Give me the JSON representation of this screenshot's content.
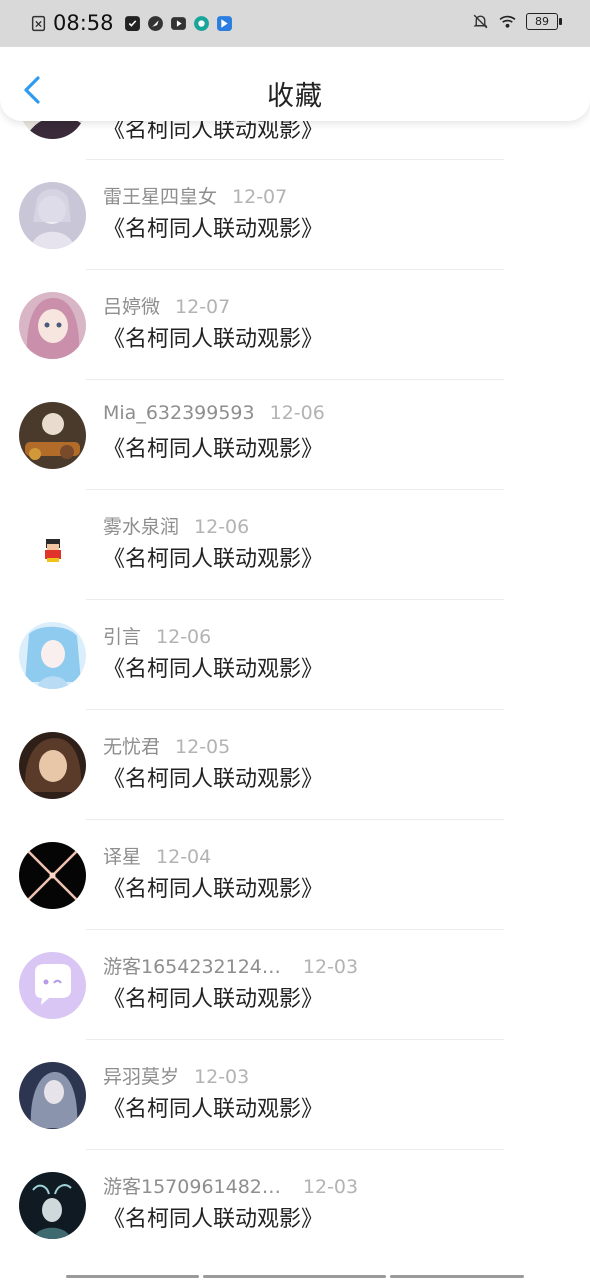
{
  "status_bar": {
    "time": "08:58",
    "battery": "89"
  },
  "header": {
    "title": "收藏"
  },
  "partial_item": {
    "title": "《名柯同人联动观影》"
  },
  "items": [
    {
      "name": "雷王星四皇女",
      "date": "12-07",
      "title": "《名柯同人联动观影》"
    },
    {
      "name": "吕婷微",
      "date": "12-07",
      "title": "《名柯同人联动观影》"
    },
    {
      "name": "Mia_632399593",
      "date": "12-06",
      "title": "《名柯同人联动观影》"
    },
    {
      "name": "雾水泉润",
      "date": "12-06",
      "title": "《名柯同人联动观影》"
    },
    {
      "name": "引言",
      "date": "12-06",
      "title": "《名柯同人联动观影》"
    },
    {
      "name": "无忧君",
      "date": "12-05",
      "title": "《名柯同人联动观影》"
    },
    {
      "name": "译星",
      "date": "12-04",
      "title": "《名柯同人联动观影》"
    },
    {
      "name": "游客1654232124…",
      "date": "12-03",
      "title": "《名柯同人联动观影》"
    },
    {
      "name": "异羽莫岁",
      "date": "12-03",
      "title": "《名柯同人联动观影》"
    },
    {
      "name": "游客1570961482…",
      "date": "12-03",
      "title": "《名柯同人联动观影》"
    }
  ],
  "colors": {
    "accent": "#2f9bf0",
    "meta_text": "#8e8e8e",
    "date_text": "#b3b3b3"
  }
}
